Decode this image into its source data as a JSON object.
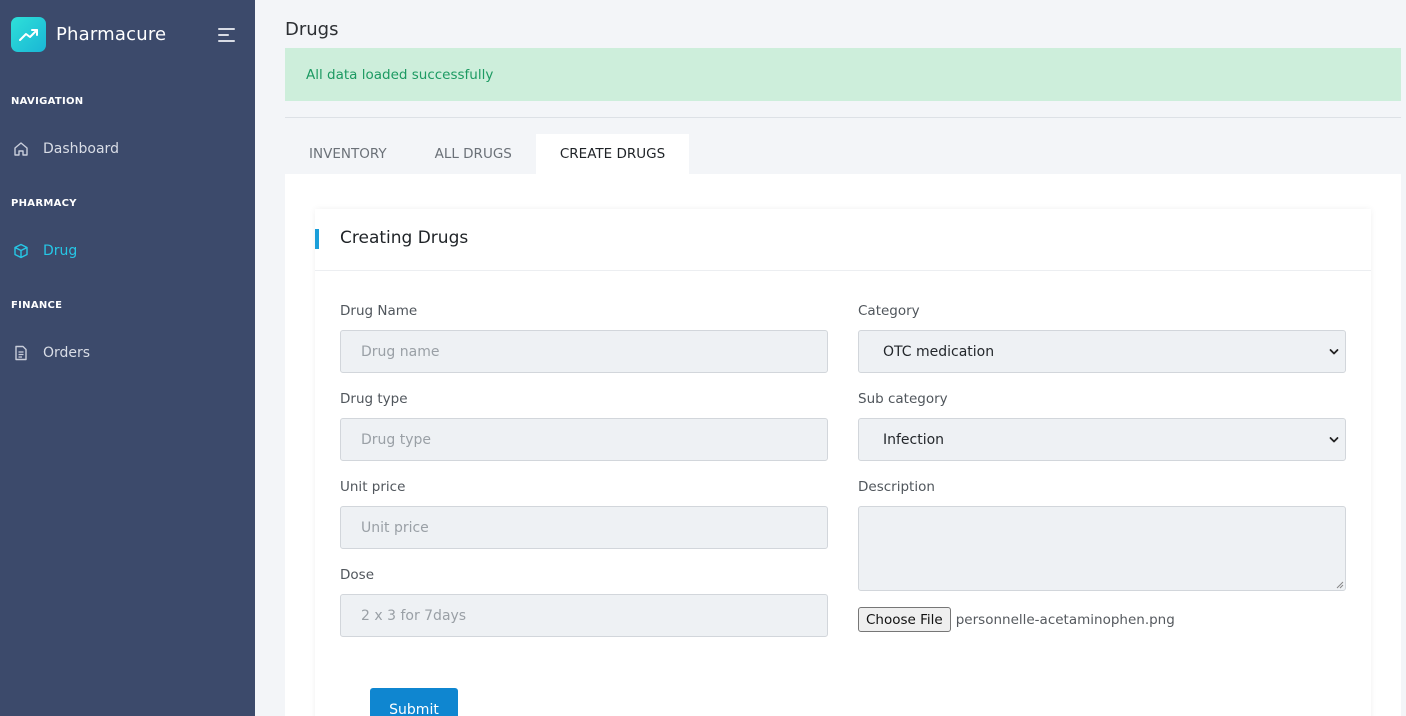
{
  "app": {
    "name": "Pharmacure"
  },
  "sidebar": {
    "sections": [
      {
        "title": "NAVIGATION",
        "items": [
          {
            "label": "Dashboard",
            "icon": "home-icon"
          }
        ]
      },
      {
        "title": "PHARMACY",
        "items": [
          {
            "label": "Drug",
            "icon": "box-icon",
            "active": true
          }
        ]
      },
      {
        "title": "FINANCE",
        "items": [
          {
            "label": "Orders",
            "icon": "document-icon"
          }
        ]
      }
    ]
  },
  "page": {
    "title": "Drugs"
  },
  "alert": {
    "message": "All data loaded successfully"
  },
  "tabs": [
    {
      "label": "INVENTORY"
    },
    {
      "label": "ALL DRUGS"
    },
    {
      "label": "CREATE DRUGS",
      "active": true
    }
  ],
  "form": {
    "title": "Creating Drugs",
    "drug_name": {
      "label": "Drug Name",
      "placeholder": "Drug name",
      "value": ""
    },
    "drug_type": {
      "label": "Drug type",
      "placeholder": "Drug type",
      "value": ""
    },
    "unit_price": {
      "label": "Unit price",
      "placeholder": "Unit price",
      "value": ""
    },
    "dose": {
      "label": "Dose",
      "placeholder": "2 x 3 for 7days",
      "value": ""
    },
    "category": {
      "label": "Category",
      "selected": "OTC medication"
    },
    "sub_category": {
      "label": "Sub category",
      "selected": "Infection"
    },
    "description": {
      "label": "Description",
      "value": ""
    },
    "file": {
      "button_label": "Choose File",
      "file_name": "personnelle-acetaminophen.png"
    },
    "submit_label": "Submit"
  },
  "colors": {
    "sidebar_bg": "#3c4a6b",
    "accent": "#26c7e6",
    "primary_button": "#0f86d0",
    "alert_bg": "#cdeedb",
    "alert_text": "#1c9a62"
  }
}
